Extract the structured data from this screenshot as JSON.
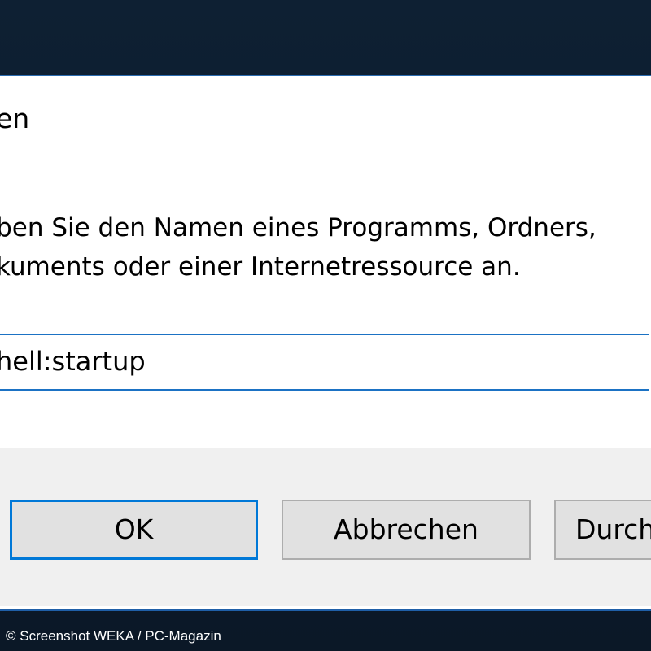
{
  "dialog": {
    "title": "en",
    "description_line1": "eben Sie den Namen eines Programms, Ordners,",
    "description_line2": "okuments oder einer Internetressource an.",
    "open_input_value": "hell:startup"
  },
  "buttons": {
    "ok": "OK",
    "cancel": "Abbrechen",
    "browse": "Durch"
  },
  "watermark": "© Screenshot WEKA / PC-Magazin",
  "colors": {
    "accent": "#0078d7",
    "button_face": "#e1e1e1",
    "button_area": "#f0f0f0",
    "desktop": "#0b1a2c"
  }
}
